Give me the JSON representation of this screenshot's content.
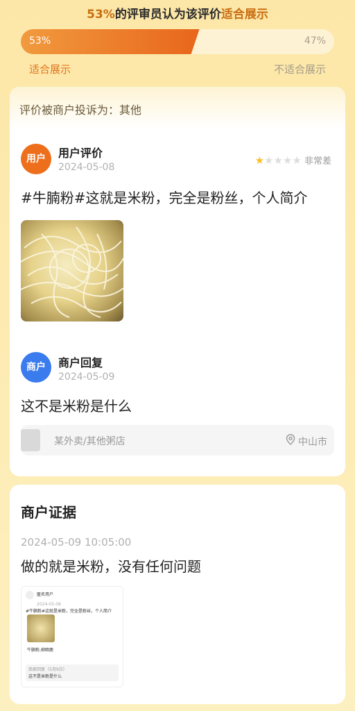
{
  "header": {
    "percent_text": "53%",
    "middle_text": "的评审员认为该评价",
    "verdict_text": "适合展示",
    "left_percent": "53%",
    "right_percent": "47%",
    "suitable_fraction": 0.53,
    "left_label": "适合展示",
    "right_label": "不适合展示"
  },
  "review_card": {
    "complaint": "评价被商户投诉为：其他",
    "user": {
      "avatar": "用户",
      "name": "用户评价",
      "date": "2024-05-08",
      "rating": 1,
      "rating_max": 5,
      "rating_label": "非常差",
      "text": "#牛腩粉#这就是米粉，完全是粉丝，个人简介"
    },
    "merchant": {
      "avatar": "商户",
      "name": "商户回复",
      "date": "2024-05-09",
      "text": "这不是米粉是什么"
    },
    "shop": {
      "name": "某外卖/其他粥店",
      "location": "中山市"
    }
  },
  "evidence_card": {
    "title": "商户证据",
    "datetime": "2024-05-09 10:05:00",
    "text": "做的就是米粉，没有任何问题",
    "screenshot": {
      "user": "匿名用户",
      "date": "2024-05-08",
      "review": "#牛腩粉#这就是米粉，完全是粉丝，个人简介",
      "tag": "牛腩粉,柳暗鹿",
      "reply_label": "商家回复（5月9日）",
      "reply": "这不是米粉是什么"
    }
  },
  "colors": {
    "accent_orange": "#e8661c",
    "merchant_blue": "#3a7bee",
    "star_yellow": "#f6bf2a"
  }
}
